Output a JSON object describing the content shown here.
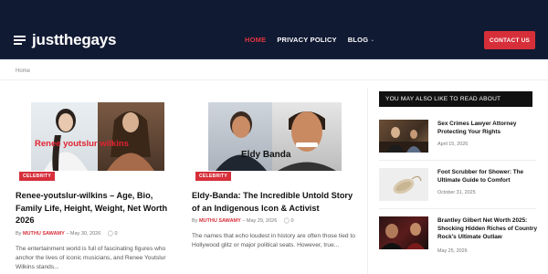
{
  "site": {
    "logo": "justthegays"
  },
  "nav": {
    "items": [
      {
        "label": "HOME",
        "active": true
      },
      {
        "label": "PRIVACY POLICY",
        "active": false
      },
      {
        "label": "BLOG",
        "active": false,
        "has_dropdown": true
      }
    ],
    "contact_label": "CONTACT US"
  },
  "breadcrumb": "Home",
  "posts": [
    {
      "thumb_text": "Renee youtslur wilkins",
      "category": "CELEBRITY",
      "title": "Renee-youtslur-wilkins – Age, Bio, Family Life, Height, Weight, Net Worth 2026",
      "by": "By",
      "author": "MUTHU SAWAMY",
      "date": "May 30, 2026",
      "comments": "0",
      "excerpt": "The entertainment world is full of fascinating figures who anchor the lives of iconic musicians, and Renee Youtslur Wilkins stands..."
    },
    {
      "thumb_text": "Eldy Banda",
      "category": "CELEBRITY",
      "title": "Eldy-Banda: The Incredible Untold Story of an Indigenous Icon & Activist",
      "by": "By",
      "author": "MUTHU SAWAMY",
      "date": "May 29, 2026",
      "comments": "0",
      "excerpt": "The names that echo loudest in history are often those tied to Hollywood glitz or major political seats. However, true..."
    }
  ],
  "sidebar": {
    "heading": "YOU MAY ALSO LIKE TO READ ABOUT",
    "items": [
      {
        "title": "Sex Crimes Lawyer Attorney Protecting Your Rights",
        "date": "April 15, 2026"
      },
      {
        "title": "Foot Scrubber for Shower: The Ultimate Guide to Comfort",
        "date": "October 31, 2025"
      },
      {
        "title": "Brantley Gilbert Net Worth 2025: Shocking Hidden Riches of Country Rock's Ultimate Outlaw",
        "date": "May 25, 2026"
      }
    ]
  },
  "colors": {
    "header_bg": "#111a33",
    "accent_red": "#d62f3a",
    "widget_bg": "#111111"
  },
  "icons": {
    "menu": "hamburger-icon",
    "comment": "comment-icon",
    "dropdown": "chevron-down-icon"
  }
}
